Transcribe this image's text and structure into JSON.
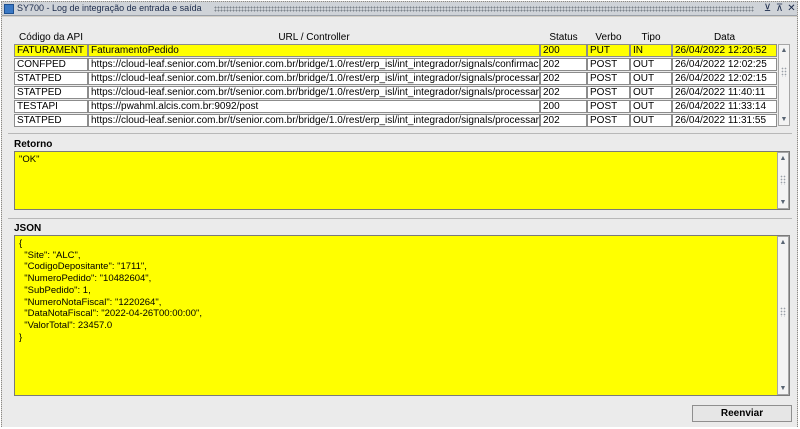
{
  "window": {
    "title": "SY700 - Log de integração de entrada e saída",
    "controls": [
      "⊻",
      "⊼",
      "✕"
    ]
  },
  "grid": {
    "headers": [
      "Código da API",
      "URL / Controller",
      "Status",
      "Verbo",
      "Tipo",
      "Data"
    ],
    "rows": [
      [
        "FATURAMENT",
        "FaturamentoPedido",
        "200",
        "PUT",
        "IN",
        "26/04/2022 12:20:52"
      ],
      [
        "CONFPED",
        "https://cloud-leaf.senior.com.br/t/senior.com.br/bridge/1.0/rest/erp_isl/int_integrador/signals/confirmaca",
        "202",
        "POST",
        "OUT",
        "26/04/2022 12:02:25"
      ],
      [
        "STATPED",
        "https://cloud-leaf.senior.com.br/t/senior.com.br/bridge/1.0/rest/erp_isl/int_integrador/signals/processarA",
        "202",
        "POST",
        "OUT",
        "26/04/2022 12:02:15"
      ],
      [
        "STATPED",
        "https://cloud-leaf.senior.com.br/t/senior.com.br/bridge/1.0/rest/erp_isl/int_integrador/signals/processarA",
        "202",
        "POST",
        "OUT",
        "26/04/2022 11:40:11"
      ],
      [
        "TESTAPI",
        "https://pwahml.alcis.com.br:9092/post",
        "200",
        "POST",
        "OUT",
        "26/04/2022 11:33:14"
      ],
      [
        "STATPED",
        "https://cloud-leaf.senior.com.br/t/senior.com.br/bridge/1.0/rest/erp_isl/int_integrador/signals/processarA",
        "202",
        "POST",
        "OUT",
        "26/04/2022 11:31:55"
      ]
    ]
  },
  "retorno": {
    "label": "Retorno",
    "value": "\"OK\""
  },
  "json": {
    "label": "JSON",
    "value": "{\n  \"Site\": \"ALC\",\n  \"CodigoDepositante\": \"1711\",\n  \"NumeroPedido\": \"10482604\",\n  \"SubPedido\": 1,\n  \"NumeroNotaFiscal\": \"1220264\",\n  \"DataNotaFiscal\": \"2022-04-26T00:00:00\",\n  \"ValorTotal\": 23457.0\n}"
  },
  "actions": {
    "reenviar_label": "Reenviar"
  },
  "colors": {
    "highlight": "#ffff00",
    "window_bg": "#ebebeb",
    "title_text": "#1b2a4a"
  }
}
